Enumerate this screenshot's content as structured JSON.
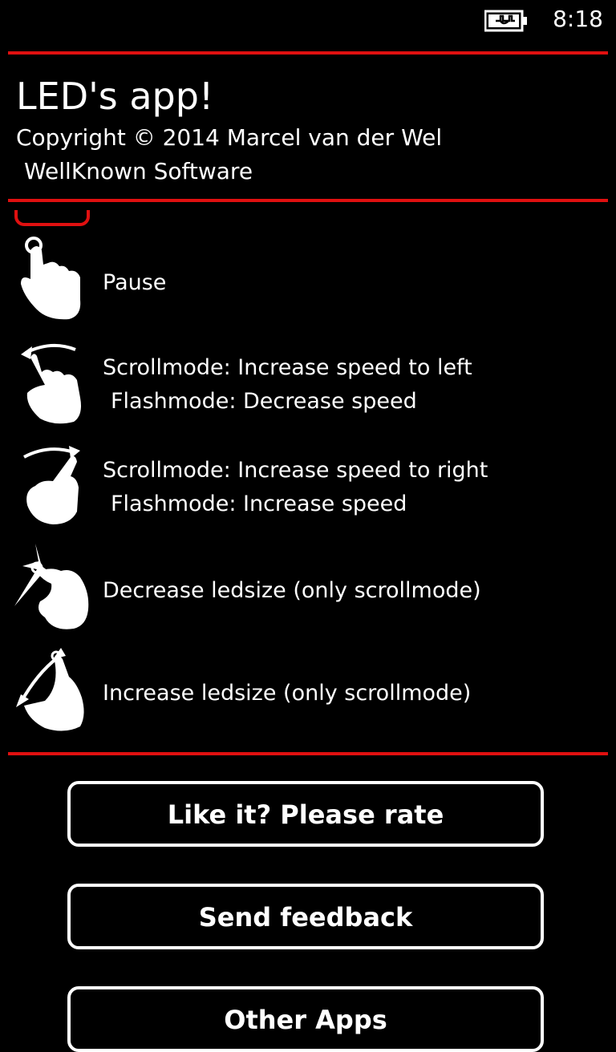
{
  "status_bar": {
    "time": "8:18",
    "battery_icon": "battery-charging-icon"
  },
  "header": {
    "title": "LED's app!",
    "copyright": "Copyright © 2014 Marcel van der Wel",
    "company": "WellKnown Software"
  },
  "gestures": [
    {
      "icon": "tap-gesture-icon",
      "line1": "Pause",
      "line2": ""
    },
    {
      "icon": "swipe-left-gesture-icon",
      "line1": "Scrollmode: Increase speed to left",
      "line2": "Flashmode: Decrease speed"
    },
    {
      "icon": "swipe-right-gesture-icon",
      "line1": "Scrollmode: Increase speed to right",
      "line2": "Flashmode: Increase speed"
    },
    {
      "icon": "pinch-in-gesture-icon",
      "line1": "Decrease ledsize (only scrollmode)",
      "line2": ""
    },
    {
      "icon": "pinch-out-gesture-icon",
      "line1": "Increase ledsize (only scrollmode)",
      "line2": ""
    }
  ],
  "buttons": {
    "rate": "Like it? Please rate",
    "feedback": "Send feedback",
    "other_apps": "Other Apps"
  },
  "colors": {
    "accent": "#e01010",
    "background": "#000000",
    "foreground": "#ffffff"
  }
}
